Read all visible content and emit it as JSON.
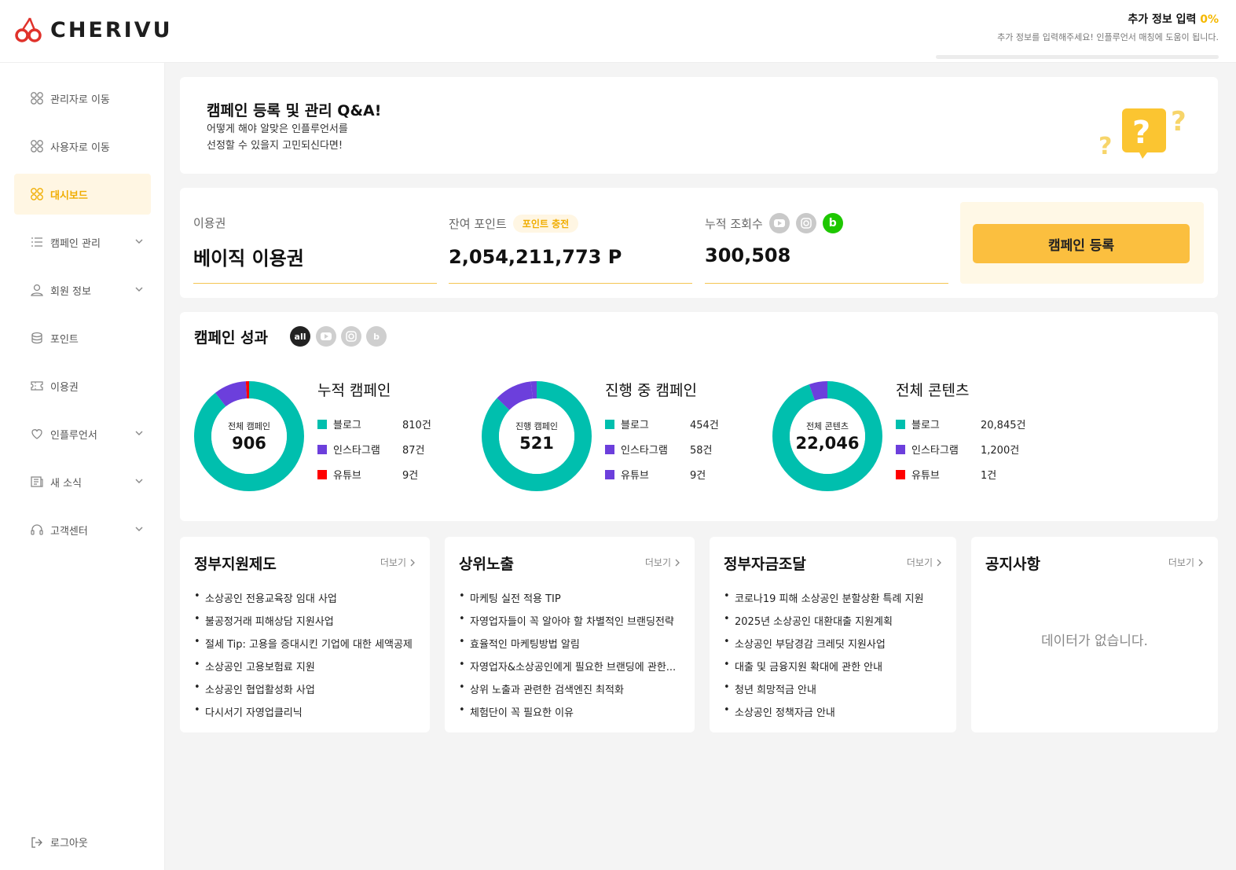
{
  "brand": {
    "name": "CHERIVU",
    "accent": "#f0ad00",
    "logo_color": "#e0322b"
  },
  "extra_info": {
    "title": "추가 정보 입력",
    "percent": "0%",
    "progress": 0,
    "subtitle": "추가 정보를 입력해주세요! 인플루언서 매칭에 도움이 됩니다."
  },
  "sidebar": {
    "items": [
      {
        "label": "관리자로 이동",
        "icon": "grid-icon"
      },
      {
        "label": "사용자로 이동",
        "icon": "grid-icon"
      },
      {
        "label": "대시보드",
        "icon": "grid-icon",
        "active": true
      },
      {
        "label": "캠페인 관리",
        "icon": "list-icon",
        "expandable": true
      },
      {
        "label": "회원 정보",
        "icon": "user-icon",
        "expandable": true
      },
      {
        "label": "포인트",
        "icon": "coin-icon"
      },
      {
        "label": "이용권",
        "icon": "ticket-icon"
      },
      {
        "label": "인플루언서",
        "icon": "heart-icon",
        "expandable": true
      },
      {
        "label": "새 소식",
        "icon": "news-icon",
        "expandable": true
      },
      {
        "label": "고객센터",
        "icon": "headset-icon",
        "expandable": true
      }
    ],
    "logout": "로그아웃"
  },
  "qa_banner": {
    "title": "캠페인 등록 및 관리 Q&A!",
    "line1": "어떻게 해야 알맞은 인플루언서를",
    "line2": "선정할 수 있을지 고민되신다면!"
  },
  "stats": {
    "ticket": {
      "label": "이용권",
      "value": "베이직 이용권"
    },
    "points": {
      "label": "잔여 포인트",
      "charge_label": "포인트 충전",
      "value": "2,054,211,773 P"
    },
    "views": {
      "label": "누적 조회수",
      "value": "300,508"
    },
    "register_button": "캠페인 등록"
  },
  "performance": {
    "title": "캠페인 성과",
    "filters": [
      "all",
      "youtube",
      "instagram",
      "blog"
    ],
    "colors": {
      "blog": "#00bfae",
      "instagram": "#6c3fdc",
      "youtube": "#ff0000"
    },
    "groups": [
      {
        "title": "누적 캠페인",
        "center_label": "전체 캠페인",
        "center_value": "906",
        "items": [
          {
            "name": "블로그",
            "value": "810건",
            "count": 810,
            "color": "#00bfae"
          },
          {
            "name": "인스타그램",
            "value": "87건",
            "count": 87,
            "color": "#6c3fdc"
          },
          {
            "name": "유튜브",
            "value": "9건",
            "count": 9,
            "color": "#ff0000"
          }
        ]
      },
      {
        "title": "진행 중 캠페인",
        "center_label": "진행 캠페인",
        "center_value": "521",
        "items": [
          {
            "name": "블로그",
            "value": "454건",
            "count": 454,
            "color": "#00bfae"
          },
          {
            "name": "인스타그램",
            "value": "58건",
            "count": 58,
            "color": "#6c3fdc"
          },
          {
            "name": "유튜브",
            "value": "9건",
            "count": 9,
            "color": "#6c3fdc"
          }
        ]
      },
      {
        "title": "전체 콘텐츠",
        "center_label": "전체 콘텐츠",
        "center_value": "22,046",
        "items": [
          {
            "name": "블로그",
            "value": "20,845건",
            "count": 20845,
            "color": "#00bfae"
          },
          {
            "name": "인스타그램",
            "value": "1,200건",
            "count": 1200,
            "color": "#6c3fdc"
          },
          {
            "name": "유튜브",
            "value": "1건",
            "count": 1,
            "color": "#ff0000"
          }
        ]
      }
    ]
  },
  "boards": [
    {
      "title": "정부지원제도",
      "more": "더보기",
      "items": [
        "소상공인 전용교육장 임대 사업",
        "불공정거래 피해상담 지원사업",
        "절세 Tip: 고용을 증대시킨 기업에 대한 세액공제",
        "소상공인 고용보험료 지원",
        "소상공인 협업활성화 사업",
        "다시서기 자영업클리닉"
      ]
    },
    {
      "title": "상위노출",
      "more": "더보기",
      "items": [
        "마케팅 실전 적용 TIP",
        "자영업자들이 꼭 알아야 할 차별적인 브랜딩전략",
        "효율적인 마케팅방법 알림",
        "자영업자&소상공인에게 필요한 브랜딩에 관한...",
        "상위 노출과 관련한 검색엔진 최적화",
        "체험단이 꼭 필요한 이유"
      ]
    },
    {
      "title": "정부자금조달",
      "more": "더보기",
      "items": [
        "코로나19 피해 소상공인 분할상환 특례 지원",
        "2025년 소상공인 대환대출 지원계획",
        "소상공인 부담경감 크레딧 지원사업",
        "대출 및 금융지원 확대에 관한 안내",
        "청년 희망적금 안내",
        "소상공인 정책자금 안내"
      ]
    },
    {
      "title": "공지사항",
      "more": "더보기",
      "empty_text": "데이터가 없습니다.",
      "items": []
    }
  ]
}
